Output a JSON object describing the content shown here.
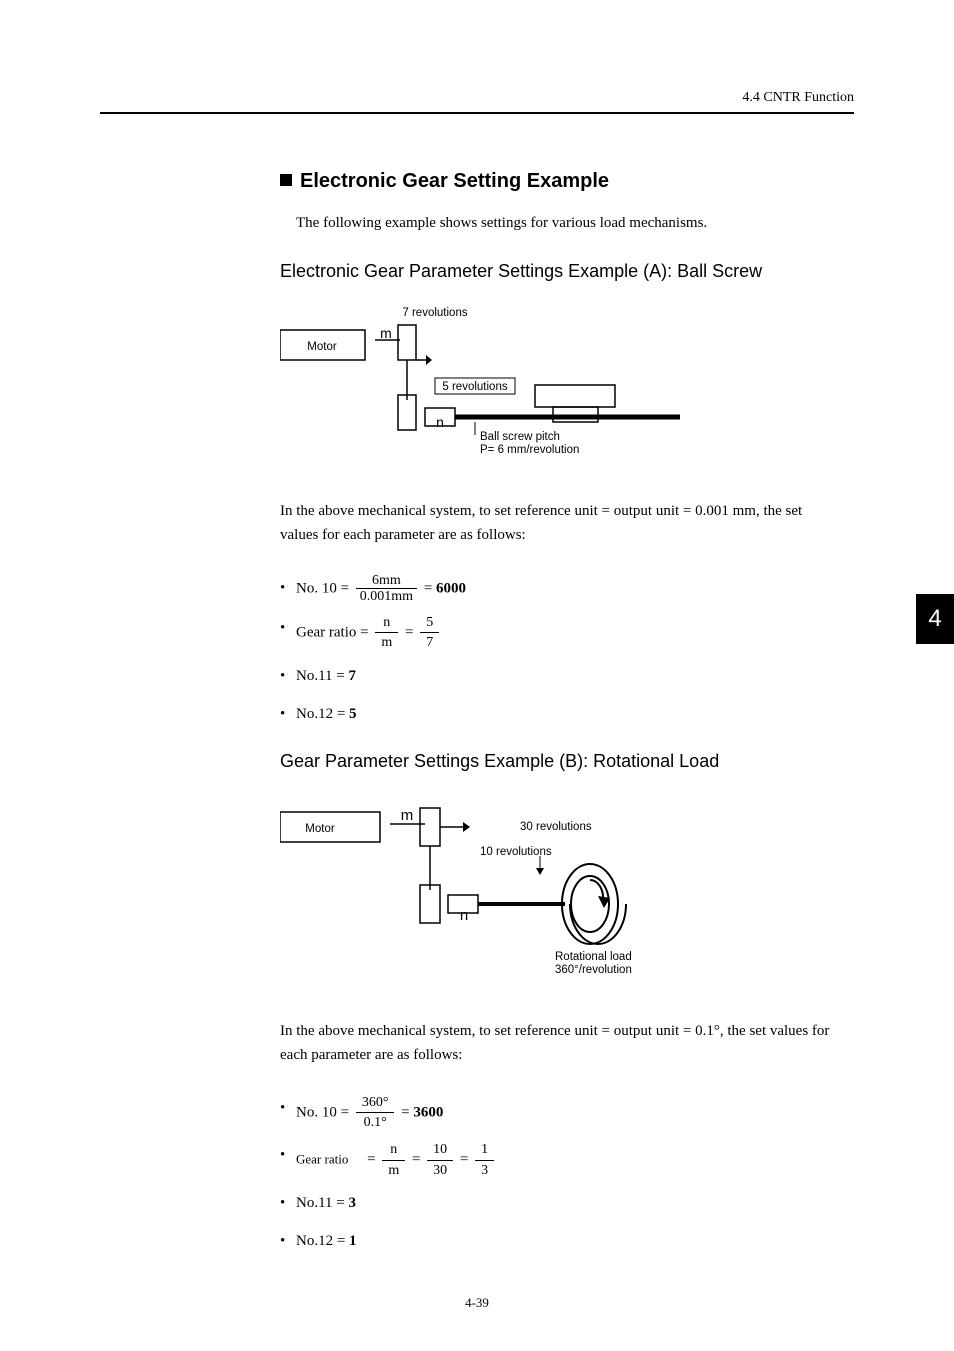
{
  "header": {
    "right": "4.4 CNTR Function"
  },
  "section": {
    "title": "Electronic Gear Setting Example",
    "intro": "The following example shows settings for various load mechanisms."
  },
  "exA": {
    "title": "Electronic Gear Parameter Settings Example (A): Ball Screw",
    "diagram": {
      "motor": "Motor",
      "m": "m",
      "n": "n",
      "seven_rev": "7 revolutions",
      "five_rev": "5 revolutions",
      "pitch1": "Ball screw pitch",
      "pitch2": "P= 6 mm/revolution"
    },
    "para": "In the above mechanical system, to set reference unit = output unit = 0.001 mm, the set values for each parameter are as follows:",
    "no10_label": "No. 10 = ",
    "no10_num": "6mm",
    "no10_den": "0.001mm",
    "no10_eq": " = ",
    "no10_val": "6000",
    "gear_label": "Gear ratio",
    "gear_eq1": " = ",
    "gear_n": "n",
    "gear_m": "m",
    "gear_eq2": " = ",
    "gear_num": "5",
    "gear_den": "7",
    "no11": "No.11 = ",
    "no11_val": "7",
    "no12": "No.12 = ",
    "no12_val": "5"
  },
  "exB": {
    "title": "Gear Parameter Settings Example (B): Rotational Load",
    "diagram": {
      "motor": "Motor",
      "m": "m",
      "n": "n",
      "thirty_rev": "30 revolutions",
      "ten_rev": "10 revolutions",
      "rot1": "Rotational load",
      "rot2": "360°/revolution"
    },
    "para": "In the above mechanical system, to set reference unit = output unit = 0.1°, the set values for each parameter are as follows:",
    "no10_label": "No. 10",
    "no10_eq0": " = ",
    "no10_num": "360°",
    "no10_den": "0.1°",
    "no10_eq": " = ",
    "no10_val": "3600",
    "gear_label": "Gear ratio",
    "gear_eq1": " = ",
    "gear_n": "n",
    "gear_m": "m",
    "gear_eq2": " = ",
    "gear_num2": "10",
    "gear_den2": "30",
    "gear_eq3": " = ",
    "gear_num3": "1",
    "gear_den3": "3",
    "no11": "No.11 = ",
    "no11_val": "3",
    "no12": "No.12 = ",
    "no12_val": "1"
  },
  "side_tab": "4",
  "page_num": "4-39",
  "chart_data": {
    "type": "table",
    "title": "Electronic Gear Setting Examples",
    "rows": [
      {
        "example": "A: Ball Screw",
        "ref_unit": "0.001 mm",
        "No.10": 6000,
        "gear_ratio_n_over_m": "5/7",
        "No.11": 7,
        "No.12": 5,
        "m_revolutions": 7,
        "n_revolutions": 5,
        "pitch": "6 mm/revolution"
      },
      {
        "example": "B: Rotational Load",
        "ref_unit": "0.1°",
        "No.10": 3600,
        "gear_ratio_n_over_m": "10/30 = 1/3",
        "No.11": 3,
        "No.12": 1,
        "m_revolutions": 30,
        "n_revolutions": 10,
        "load": "360°/revolution"
      }
    ]
  }
}
